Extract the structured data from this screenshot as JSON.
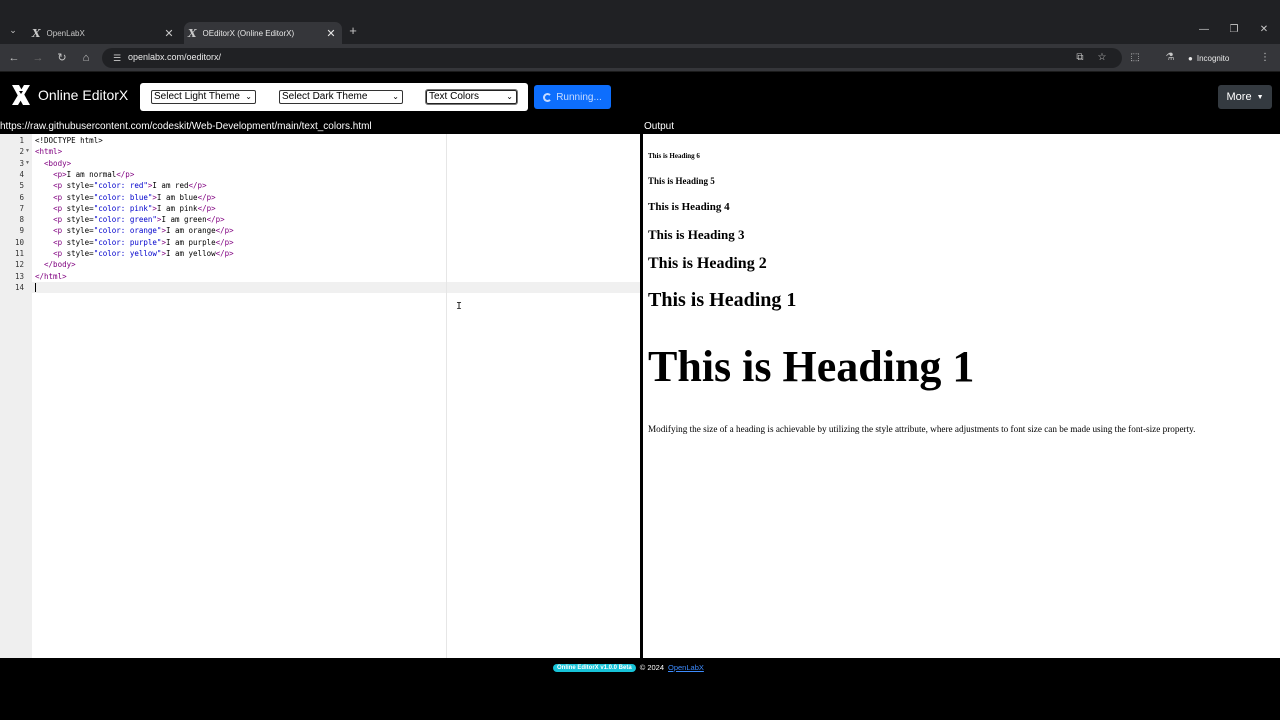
{
  "browser": {
    "tabs": [
      {
        "title": "OpenLabX",
        "active": false
      },
      {
        "title": "OEditorX (Online EditorX)",
        "active": true
      }
    ],
    "url": "openlabx.com/oeditorx/",
    "incognito_label": "Incognito"
  },
  "app": {
    "logo_text": "Online EditorX",
    "light_theme_select": "Select Light Theme",
    "dark_theme_select": "Select Dark Theme",
    "example_select": "Text Colors",
    "run_button": "Running...",
    "more_button": "More"
  },
  "editor": {
    "file_url": "https://raw.githubusercontent.com/codeskit/Web-Development/main/text_colors.html",
    "line_numbers": [
      "1",
      "2",
      "3",
      "4",
      "5",
      "6",
      "7",
      "8",
      "9",
      "10",
      "11",
      "12",
      "13",
      "14"
    ]
  },
  "output": {
    "label": "Output",
    "headings": [
      "This is Heading 6",
      "This is Heading 5",
      "This is Heading 4",
      "This is Heading 3",
      "This is Heading 2",
      "This is Heading 1",
      "This is Heading 1"
    ],
    "paragraph": "Modifying the size of a heading is achievable by utilizing the style attribute, where adjustments to font size can be made using the font-size property."
  },
  "footer": {
    "badge": "Online EditorX v1.0.0 Beta",
    "copyright": "© 2024",
    "link": "OpenLabX"
  },
  "colors": {
    "run_button": "#0d6efd",
    "more_button": "#343a40",
    "badge": "#17c3d8",
    "tag_color": "#800080",
    "string_color": "#0000cc"
  }
}
